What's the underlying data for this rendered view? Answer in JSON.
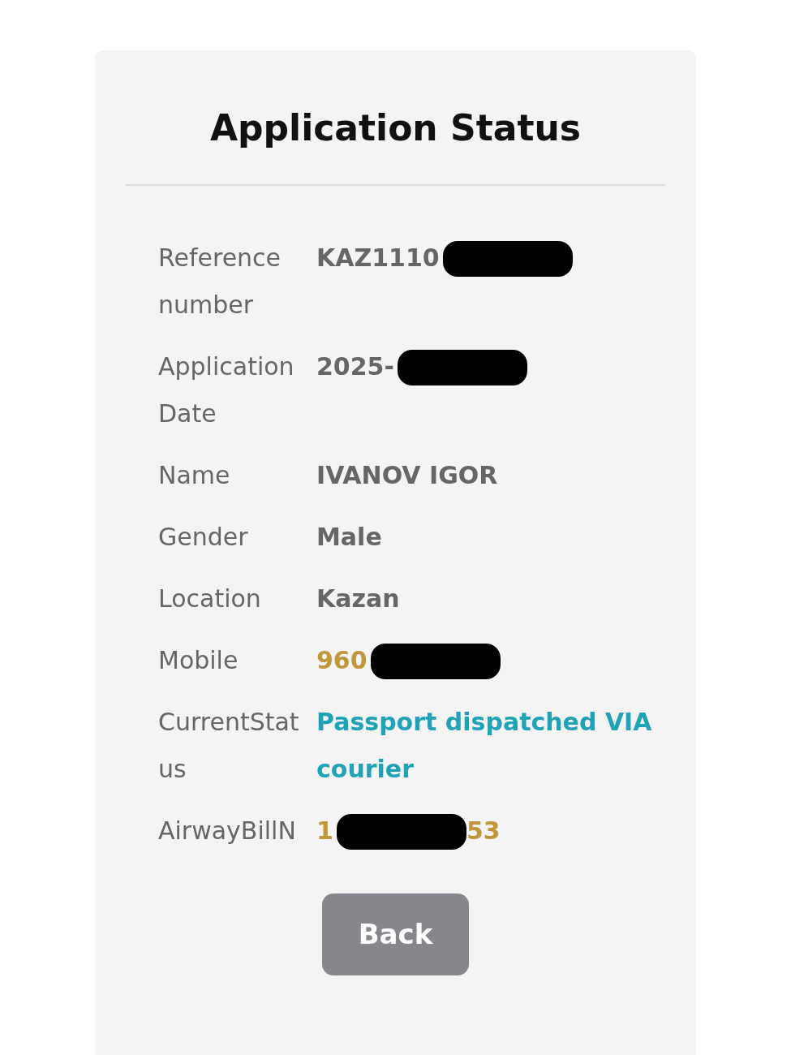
{
  "title": "Application Status",
  "rows": [
    {
      "label": "Reference number",
      "kind": "plain",
      "value": "KAZ1110",
      "redacted": true
    },
    {
      "label": "ApplicationDate",
      "kind": "plain",
      "value": "2025-",
      "redacted": true
    },
    {
      "label": "Name",
      "kind": "plain",
      "value": "IVANOV IGOR",
      "redacted": false
    },
    {
      "label": "Gender",
      "kind": "plain",
      "value": "Male",
      "redacted": false
    },
    {
      "label": "Location",
      "kind": "plain",
      "value": "Kazan",
      "redacted": false
    },
    {
      "label": "Mobile",
      "kind": "phone",
      "value": "960",
      "redacted": true
    },
    {
      "label": "CurrentStatus",
      "kind": "status",
      "value": "Passport dispatched VIA courier",
      "redacted": false
    },
    {
      "label": "AirwayBillN",
      "kind": "phone",
      "value": "1",
      "redacted": true,
      "value_end": "53"
    }
  ],
  "back_button": "Back"
}
